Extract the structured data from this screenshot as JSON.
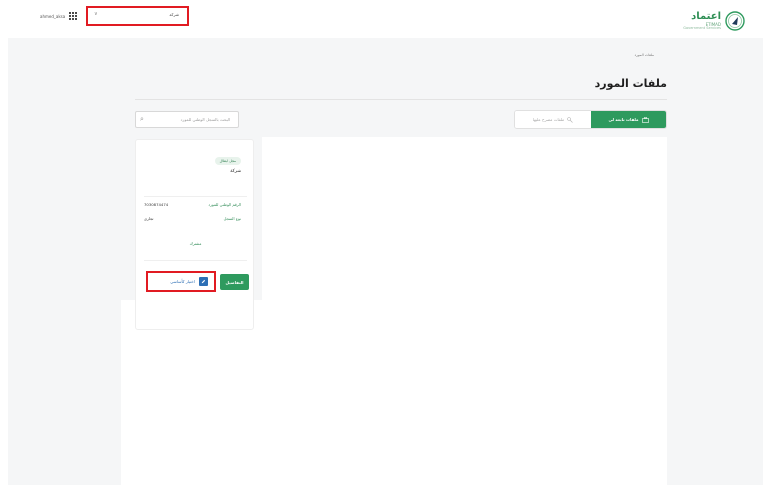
{
  "header": {
    "logo": {
      "ar": "اعتماد",
      "en": "ETIMAD",
      "sub": "Government Services"
    },
    "user": "ahmed_aksa",
    "org_select_value": "شركة"
  },
  "breadcrumb": "ملفات المورد",
  "page_title": "ملفات المورد",
  "search": {
    "placeholder": "البحث بالسجل الوطني للمورد"
  },
  "filters": {
    "mine_label": "ملفات تابعة لي",
    "other_label": "ملفات مصرح عليها"
  },
  "card": {
    "type_pill": "مجل ابطال",
    "name": "شركة",
    "national_id_label": "الرقم الوطني للمورد",
    "national_id_value": "7030874474",
    "record_type_label": "نوع السجل",
    "record_type_value": "تجاري",
    "shared_label": "مشترك",
    "details_label": "التفاصيل",
    "primary_label": "اختيار كأساسي"
  },
  "colors": {
    "brand_green": "#2e9a5e",
    "highlight_red": "#e11b22",
    "link_blue": "#2d6fb5"
  }
}
